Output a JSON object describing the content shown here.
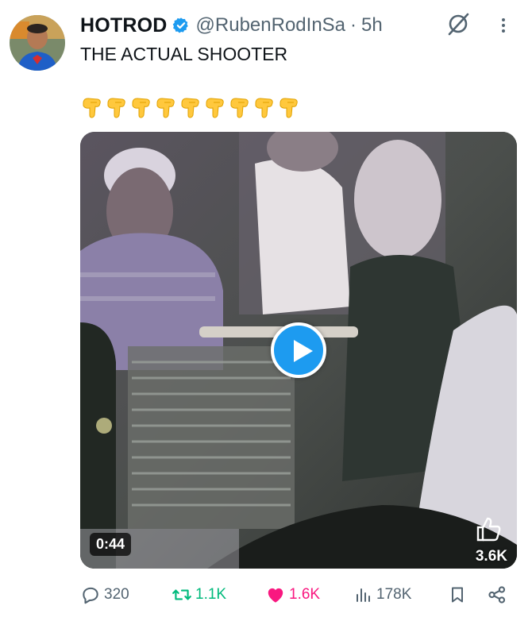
{
  "author": {
    "name": "HOTROD",
    "handle": "@RubenRodInSa",
    "separator": "·",
    "time": "5h",
    "verified": true
  },
  "tweet": {
    "text": "THE ACTUAL SHOOTER",
    "emoji": [
      "👇",
      "👇",
      "👇",
      "👇",
      "👇",
      "👇",
      "👇",
      "👇",
      "👇"
    ]
  },
  "media": {
    "type": "video",
    "duration": "0:44",
    "overlay_reaction_icon": "thumbs-up-icon",
    "overlay_reaction_count": "3.6K"
  },
  "actions": {
    "replies": "320",
    "reposts": "1.1K",
    "likes": "1.6K",
    "views": "178K"
  },
  "colors": {
    "accent": "#1d9bf0",
    "repost": "#00ba7c",
    "like": "#f91880",
    "muted": "#536471",
    "text": "#0f1419"
  },
  "icons": [
    "verified-badge-icon",
    "grok-icon",
    "more-icon",
    "play-icon",
    "reply-icon",
    "repost-icon",
    "heart-icon",
    "views-icon",
    "bookmark-icon",
    "share-icon"
  ]
}
